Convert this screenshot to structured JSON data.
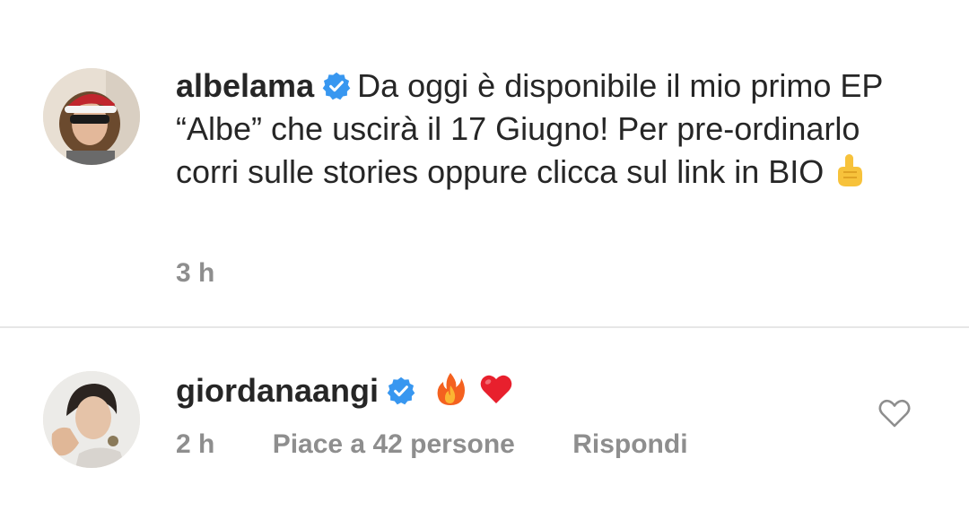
{
  "comments": [
    {
      "username": "albelama",
      "verified": true,
      "text": "Da oggi è disponibile il mio primo EP “Albe” che uscirà il 17 Giugno! Per pre-ordinarlo corri sulle stories oppure clicca sul link in BIO",
      "emoji": "point-up-icon",
      "time": "3 h"
    },
    {
      "username": "giordanaangi",
      "verified": true,
      "emoji": [
        "fire-icon",
        "red-heart-icon"
      ],
      "time": "2 h",
      "likes_label": "Piace a 42 persone",
      "reply_label": "Rispondi",
      "like_icon": "heart-outline-icon"
    }
  ],
  "colors": {
    "verified_blue": "#3897f0",
    "text_primary": "#262626",
    "text_secondary": "#8e8e8e",
    "divider": "#e6e6e6"
  }
}
